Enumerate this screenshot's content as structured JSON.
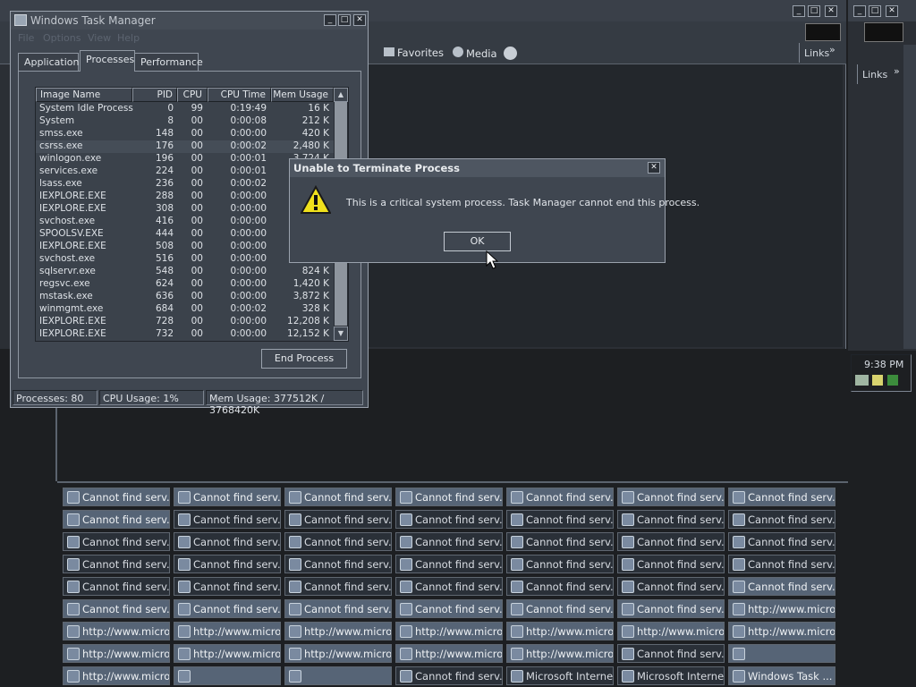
{
  "bg_windows": {
    "links_label_1": "Links",
    "links_label_2": "Links",
    "toolbar_favorites": "Favorites",
    "toolbar_media": "Media",
    "chevrons": "»"
  },
  "tray": {
    "time": "9:38 PM"
  },
  "taskmgr": {
    "title": "Windows Task Manager",
    "menu": [
      "File",
      "Options",
      "View",
      "Help"
    ],
    "tabs": [
      "Applications",
      "Processes",
      "Performance"
    ],
    "columns": [
      "Image Name",
      "PID",
      "CPU",
      "CPU Time",
      "Mem Usage"
    ],
    "rows": [
      [
        "System Idle Process",
        "0",
        "99",
        "0:19:49",
        "16 K"
      ],
      [
        "System",
        "8",
        "00",
        "0:00:08",
        "212 K"
      ],
      [
        "smss.exe",
        "148",
        "00",
        "0:00:00",
        "420 K"
      ],
      [
        "csrss.exe",
        "176",
        "00",
        "0:00:02",
        "2,480 K"
      ],
      [
        "winlogon.exe",
        "196",
        "00",
        "0:00:01",
        "3,724 K"
      ],
      [
        "services.exe",
        "224",
        "00",
        "0:00:01",
        ""
      ],
      [
        "lsass.exe",
        "236",
        "00",
        "0:00:02",
        ""
      ],
      [
        "IEXPLORE.EXE",
        "288",
        "00",
        "0:00:00",
        ""
      ],
      [
        "IEXPLORE.EXE",
        "308",
        "00",
        "0:00:00",
        ""
      ],
      [
        "svchost.exe",
        "416",
        "00",
        "0:00:00",
        ""
      ],
      [
        "SPOOLSV.EXE",
        "444",
        "00",
        "0:00:00",
        ""
      ],
      [
        "IEXPLORE.EXE",
        "508",
        "00",
        "0:00:00",
        ""
      ],
      [
        "svchost.exe",
        "516",
        "00",
        "0:00:00",
        ""
      ],
      [
        "sqlservr.exe",
        "548",
        "00",
        "0:00:00",
        "824 K"
      ],
      [
        "regsvc.exe",
        "624",
        "00",
        "0:00:00",
        "1,420 K"
      ],
      [
        "mstask.exe",
        "636",
        "00",
        "0:00:00",
        "3,872 K"
      ],
      [
        "winmgmt.exe",
        "684",
        "00",
        "0:00:02",
        "328 K"
      ],
      [
        "IEXPLORE.EXE",
        "728",
        "00",
        "0:00:00",
        "12,208 K"
      ],
      [
        "IEXPLORE.EXE",
        "732",
        "00",
        "0:00:00",
        "12,152 K"
      ]
    ],
    "selected_row": 3,
    "end_process": "End Process",
    "status": {
      "processes": "Processes: 80",
      "cpu": "CPU Usage: 1%",
      "mem": "Mem Usage: 377512K / 3768420K"
    }
  },
  "dialog": {
    "title": "Unable to Terminate Process",
    "message": "This is a critical system process.  Task Manager cannot end this process.",
    "ok": "OK"
  },
  "taskbar": {
    "cannot": "Cannot find serv...",
    "http": "http://www.micro...",
    "mie": "Microsoft Interne...",
    "wtm": "Windows Task ...",
    "grid": [
      [
        "C",
        "C",
        "C",
        "C",
        "C",
        "C",
        "C"
      ],
      [
        "C",
        "C",
        "C",
        "C",
        "C",
        "C",
        "C"
      ],
      [
        "C",
        "C",
        "C",
        "C",
        "C",
        "C",
        "C"
      ],
      [
        "C",
        "C",
        "C",
        "C",
        "C",
        "C",
        "C"
      ],
      [
        "C",
        "C",
        "C",
        "C",
        "C",
        "C",
        "C"
      ],
      [
        "C",
        "C",
        "C",
        "C",
        "C",
        "C",
        "H"
      ],
      [
        "H",
        "H",
        "H",
        "H",
        "H",
        "H",
        "H"
      ],
      [
        "H",
        "H",
        "H",
        "H",
        "H",
        "C",
        "E"
      ],
      [
        "H",
        "E",
        "E",
        "C",
        "M",
        "M",
        "W"
      ]
    ],
    "highlighted": [
      [
        0,
        0
      ],
      [
        0,
        1
      ],
      [
        0,
        2
      ],
      [
        0,
        3
      ],
      [
        0,
        4
      ],
      [
        0,
        5
      ],
      [
        0,
        6
      ],
      [
        1,
        0
      ],
      [
        4,
        6
      ],
      [
        5,
        0
      ],
      [
        5,
        1
      ],
      [
        5,
        2
      ],
      [
        5,
        3
      ],
      [
        5,
        4
      ],
      [
        5,
        5
      ],
      [
        5,
        6
      ],
      [
        6,
        0
      ],
      [
        6,
        1
      ],
      [
        6,
        2
      ],
      [
        6,
        3
      ],
      [
        6,
        4
      ],
      [
        6,
        5
      ],
      [
        6,
        6
      ],
      [
        7,
        0
      ],
      [
        7,
        1
      ],
      [
        7,
        2
      ],
      [
        7,
        3
      ],
      [
        7,
        4
      ],
      [
        7,
        6
      ],
      [
        8,
        0
      ],
      [
        8,
        1
      ],
      [
        8,
        2
      ],
      [
        8,
        6
      ]
    ]
  }
}
